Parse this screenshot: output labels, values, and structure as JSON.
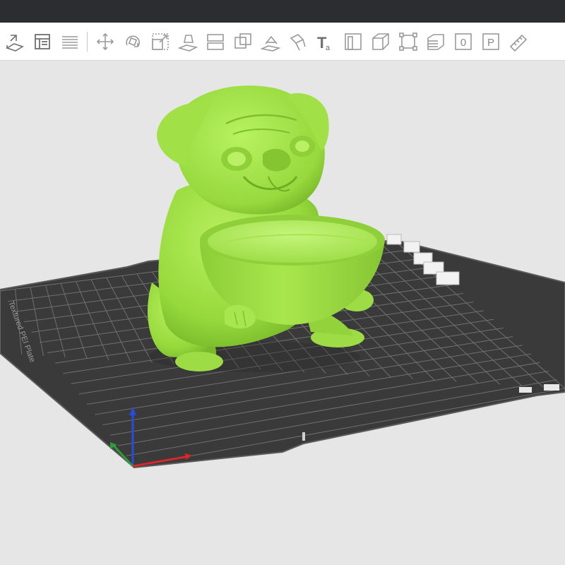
{
  "colors": {
    "background": "#e6e6e6",
    "titlebar": "#2c2d31",
    "toolbar": "#ffffff",
    "icon_stroke": "#7a7a7a",
    "bed": "#3a3a3a",
    "bed_grid": "#6e6e6e",
    "model": "#a4e64a",
    "axis_x": "#d8262a",
    "axis_y": "#2e9a3a",
    "axis_z": "#2a4bd6"
  },
  "toolbar": {
    "items": [
      {
        "icon": "import-model-icon"
      },
      {
        "icon": "layout-panel-icon"
      },
      {
        "icon": "layer-list-icon"
      },
      {
        "type": "separator"
      },
      {
        "icon": "move-icon"
      },
      {
        "icon": "rotate-icon"
      },
      {
        "icon": "scale-icon"
      },
      {
        "icon": "place-on-face-icon"
      },
      {
        "icon": "cut-icon"
      },
      {
        "icon": "mesh-boolean-icon"
      },
      {
        "icon": "support-paint-icon"
      },
      {
        "icon": "seam-paint-icon"
      },
      {
        "icon": "text-tool-icon",
        "label": "Ta"
      },
      {
        "icon": "measure-icon"
      },
      {
        "icon": "perspective-view-icon"
      },
      {
        "icon": "fit-view-icon"
      },
      {
        "icon": "layers-view-icon"
      },
      {
        "icon": "zero-label-icon",
        "label": "0"
      },
      {
        "icon": "p-label-icon",
        "label": "P"
      },
      {
        "icon": "ruler-icon"
      }
    ]
  },
  "viewport": {
    "bed_label": "Textured PEI Plate"
  }
}
